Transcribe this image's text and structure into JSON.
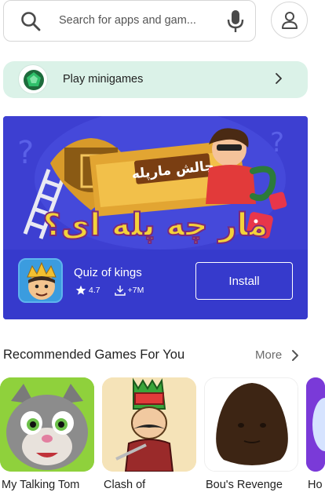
{
  "search": {
    "placeholder": "Search for apps and gam..."
  },
  "minigames": {
    "label": "Play minigames"
  },
  "banner": {
    "art_title_small": "چالش مارپله",
    "art_title_big": "مار چه پله ای؟",
    "app_name": "Quiz of kings",
    "rating": "4.7",
    "downloads": "+7M",
    "install_label": "Install"
  },
  "recommended": {
    "title": "Recommended Games For You",
    "more_label": "More",
    "games": [
      {
        "title": "My Talking Tom"
      },
      {
        "title": "Clash of"
      },
      {
        "title": "Bou's Revenge"
      },
      {
        "title": "Ho"
      }
    ]
  }
}
